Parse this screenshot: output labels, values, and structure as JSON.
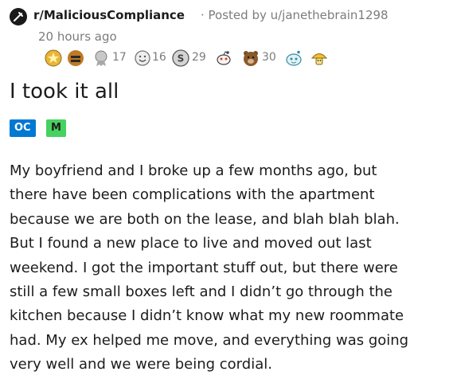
{
  "post": {
    "subreddit": "r/MaliciousCompliance",
    "posted_by": "· Posted by u/janethebrain1298",
    "timestamp": "20 hours ago",
    "title": "I took it all",
    "flairs": [
      "OC",
      "M"
    ],
    "body_lines": [
      "My boyfriend and I broke up a few months ago, but",
      "there have been complications with the apartment",
      "because we are both on the lease, and blah blah blah.",
      "But I found a new place to live and moved out last",
      "weekend. I got the important stuff out, but there were",
      "still a few small boxes left and I didn’t go through the",
      "kitchen because I didn’t know what my new roommate",
      "had. My ex helped me move, and everything was going",
      "very well and we were being cordial."
    ]
  },
  "awards": [
    {
      "icon": "gold-star-award-icon",
      "count": ""
    },
    {
      "icon": "helpful-award-icon",
      "count": ""
    },
    {
      "icon": "silver-ribbon-award-icon",
      "count": "17"
    },
    {
      "icon": "wholesome-face-award-icon",
      "count": "16"
    },
    {
      "icon": "silver-coin-award-icon",
      "count": "29"
    },
    {
      "icon": "snoo-award-icon",
      "count": ""
    },
    {
      "icon": "bear-award-icon",
      "count": "30"
    },
    {
      "icon": "snoo-face-award-icon",
      "count": ""
    },
    {
      "icon": "gold-mushroom-award-icon",
      "count": ""
    }
  ],
  "colors": {
    "oc_flair": "#0079d3",
    "m_flair": "#46d160",
    "muted_text": "#7c7c7c",
    "text": "#1c1c1c"
  }
}
